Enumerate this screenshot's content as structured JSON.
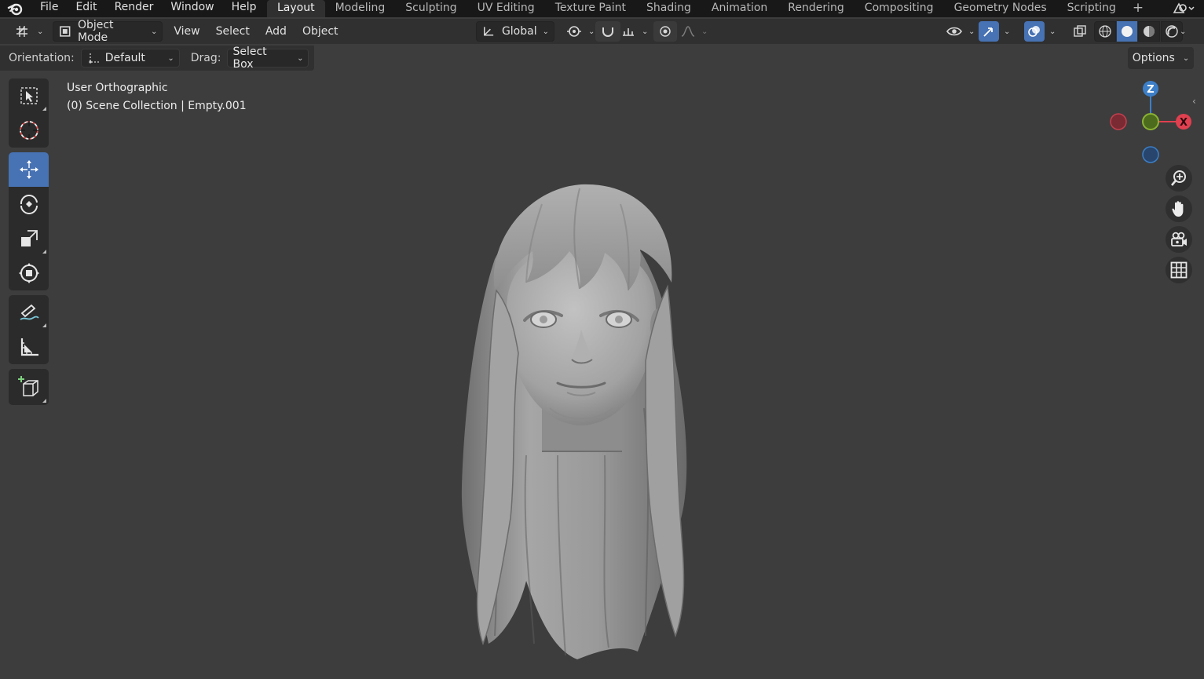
{
  "menu": [
    "File",
    "Edit",
    "Render",
    "Window",
    "Help"
  ],
  "workspaces": [
    "Layout",
    "Modeling",
    "Sculpting",
    "UV Editing",
    "Texture Paint",
    "Shading",
    "Animation",
    "Rendering",
    "Compositing",
    "Geometry Nodes",
    "Scripting"
  ],
  "active_workspace": "Layout",
  "header": {
    "mode": "Object Mode",
    "view": "View",
    "select": "Select",
    "add": "Add",
    "object": "Object",
    "transform_orientation": "Global"
  },
  "tool_settings": {
    "orientation_label": "Orientation:",
    "orientation_value": "Default",
    "drag_label": "Drag:",
    "drag_value": "Select Box",
    "options": "Options"
  },
  "viewport": {
    "view_name": "User Orthographic",
    "collection_info": "(0) Scene Collection | Empty.001"
  },
  "gizmo": {
    "z": "Z",
    "x": "X"
  },
  "colors": {
    "accent": "#4772b3",
    "x_axis": "#e0404f",
    "y_axis": "#8bb333",
    "z_axis": "#3c7fc8"
  }
}
